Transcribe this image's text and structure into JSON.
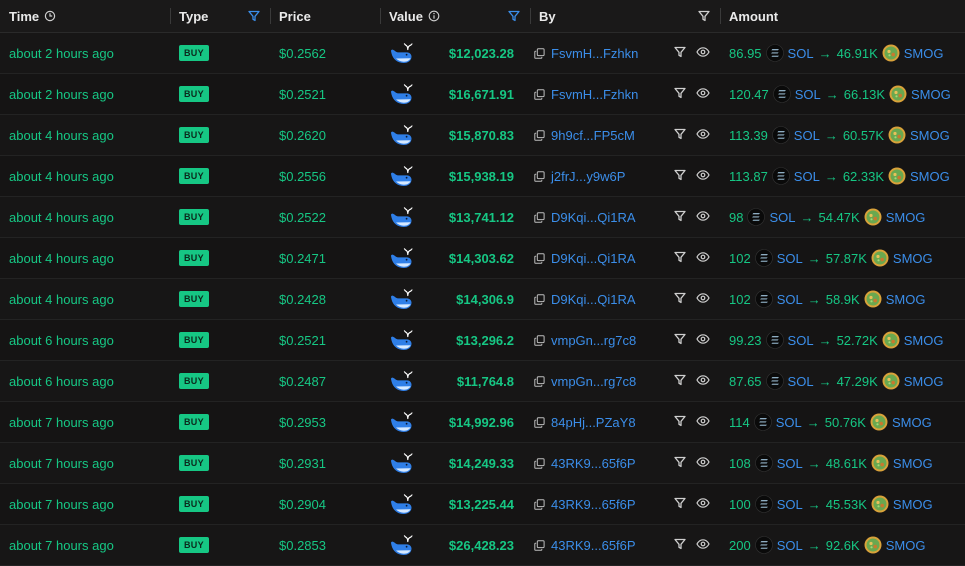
{
  "headers": {
    "time": "Time",
    "type": "Type",
    "price": "Price",
    "value": "Value",
    "by": "By",
    "amount": "Amount"
  },
  "colors": {
    "green": "#16c784",
    "blue": "#3b8eea",
    "background": "#151414"
  },
  "rows": [
    {
      "time": "about 2 hours ago",
      "type": "BUY",
      "price": "$0.2562",
      "value": "$12,023.28",
      "maker": "FsvmH...Fzhkn",
      "amount_in": "86.95",
      "token_in": "SOL",
      "amount_out": "46.91K",
      "token_out": "SMOG"
    },
    {
      "time": "about 2 hours ago",
      "type": "BUY",
      "price": "$0.2521",
      "value": "$16,671.91",
      "maker": "FsvmH...Fzhkn",
      "amount_in": "120.47",
      "token_in": "SOL",
      "amount_out": "66.13K",
      "token_out": "SMOG"
    },
    {
      "time": "about 4 hours ago",
      "type": "BUY",
      "price": "$0.2620",
      "value": "$15,870.83",
      "maker": "9h9cf...FP5cM",
      "amount_in": "113.39",
      "token_in": "SOL",
      "amount_out": "60.57K",
      "token_out": "SMOG"
    },
    {
      "time": "about 4 hours ago",
      "type": "BUY",
      "price": "$0.2556",
      "value": "$15,938.19",
      "maker": "j2frJ...y9w6P",
      "amount_in": "113.87",
      "token_in": "SOL",
      "amount_out": "62.33K",
      "token_out": "SMOG"
    },
    {
      "time": "about 4 hours ago",
      "type": "BUY",
      "price": "$0.2522",
      "value": "$13,741.12",
      "maker": "D9Kqi...Qi1RA",
      "amount_in": "98",
      "token_in": "SOL",
      "amount_out": "54.47K",
      "token_out": "SMOG"
    },
    {
      "time": "about 4 hours ago",
      "type": "BUY",
      "price": "$0.2471",
      "value": "$14,303.62",
      "maker": "D9Kqi...Qi1RA",
      "amount_in": "102",
      "token_in": "SOL",
      "amount_out": "57.87K",
      "token_out": "SMOG"
    },
    {
      "time": "about 4 hours ago",
      "type": "BUY",
      "price": "$0.2428",
      "value": "$14,306.9",
      "maker": "D9Kqi...Qi1RA",
      "amount_in": "102",
      "token_in": "SOL",
      "amount_out": "58.9K",
      "token_out": "SMOG"
    },
    {
      "time": "about 6 hours ago",
      "type": "BUY",
      "price": "$0.2521",
      "value": "$13,296.2",
      "maker": "vmpGn...rg7c8",
      "amount_in": "99.23",
      "token_in": "SOL",
      "amount_out": "52.72K",
      "token_out": "SMOG"
    },
    {
      "time": "about 6 hours ago",
      "type": "BUY",
      "price": "$0.2487",
      "value": "$11,764.8",
      "maker": "vmpGn...rg7c8",
      "amount_in": "87.65",
      "token_in": "SOL",
      "amount_out": "47.29K",
      "token_out": "SMOG"
    },
    {
      "time": "about 7 hours ago",
      "type": "BUY",
      "price": "$0.2953",
      "value": "$14,992.96",
      "maker": "84pHj...PZaY8",
      "amount_in": "114",
      "token_in": "SOL",
      "amount_out": "50.76K",
      "token_out": "SMOG"
    },
    {
      "time": "about 7 hours ago",
      "type": "BUY",
      "price": "$0.2931",
      "value": "$14,249.33",
      "maker": "43RK9...65f6P",
      "amount_in": "108",
      "token_in": "SOL",
      "amount_out": "48.61K",
      "token_out": "SMOG"
    },
    {
      "time": "about 7 hours ago",
      "type": "BUY",
      "price": "$0.2904",
      "value": "$13,225.44",
      "maker": "43RK9...65f6P",
      "amount_in": "100",
      "token_in": "SOL",
      "amount_out": "45.53K",
      "token_out": "SMOG"
    },
    {
      "time": "about 7 hours ago",
      "type": "BUY",
      "price": "$0.2853",
      "value": "$26,428.23",
      "maker": "43RK9...65f6P",
      "amount_in": "200",
      "token_in": "SOL",
      "amount_out": "92.6K",
      "token_out": "SMOG"
    }
  ]
}
